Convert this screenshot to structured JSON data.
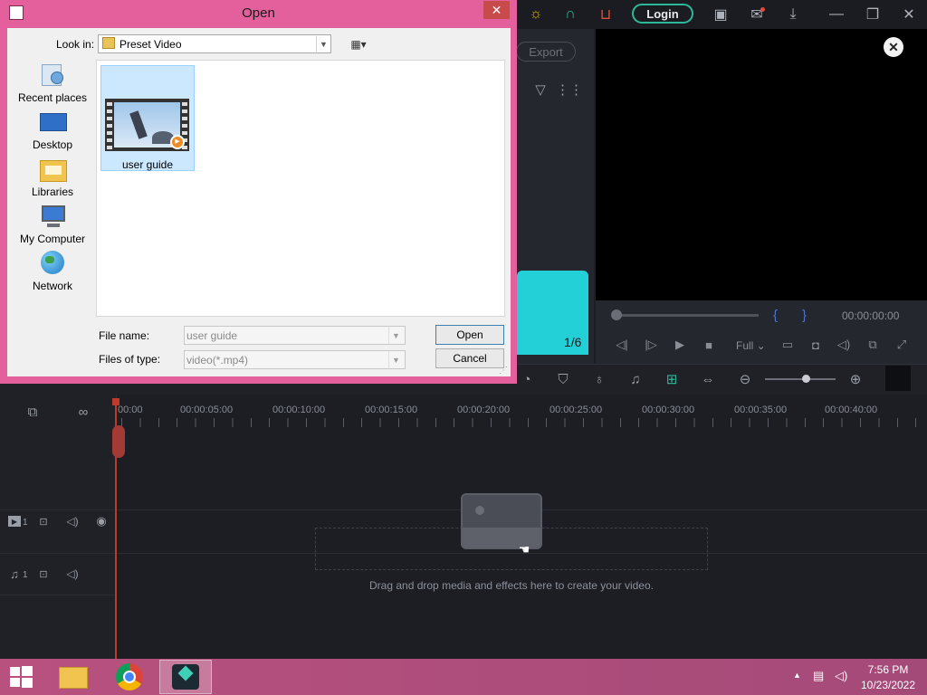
{
  "app": {
    "login_label": "Login",
    "export_label": "Export",
    "media_counter": "1/6",
    "preview_time": "00:00:00:00",
    "preview_quality": "Full",
    "timeline_ticks": [
      "00:00",
      "00:00:05:00",
      "00:00:10:00",
      "00:00:15:00",
      "00:00:20:00",
      "00:00:25:00",
      "00:00:30:00",
      "00:00:35:00",
      "00:00:40:00"
    ],
    "video_track_label": "1",
    "audio_track_label": "1",
    "drop_hint": "Drag and drop media and effects here to create your video.",
    "accent_color": "#2db89a"
  },
  "dialog": {
    "title": "Open",
    "look_in_label": "Look in:",
    "look_in_value": "Preset Video",
    "places": [
      "Recent places",
      "Desktop",
      "Libraries",
      "My Computer",
      "Network"
    ],
    "files": [
      {
        "name": "user guide",
        "icon": "video-file-icon"
      }
    ],
    "file_name_label": "File name:",
    "file_name_value": "user guide",
    "file_type_label": "Files of type:",
    "file_type_value": "video(*.mp4)",
    "open_label": "Open",
    "cancel_label": "Cancel"
  },
  "taskbar": {
    "time": "7:56 PM",
    "date": "10/23/2022"
  }
}
